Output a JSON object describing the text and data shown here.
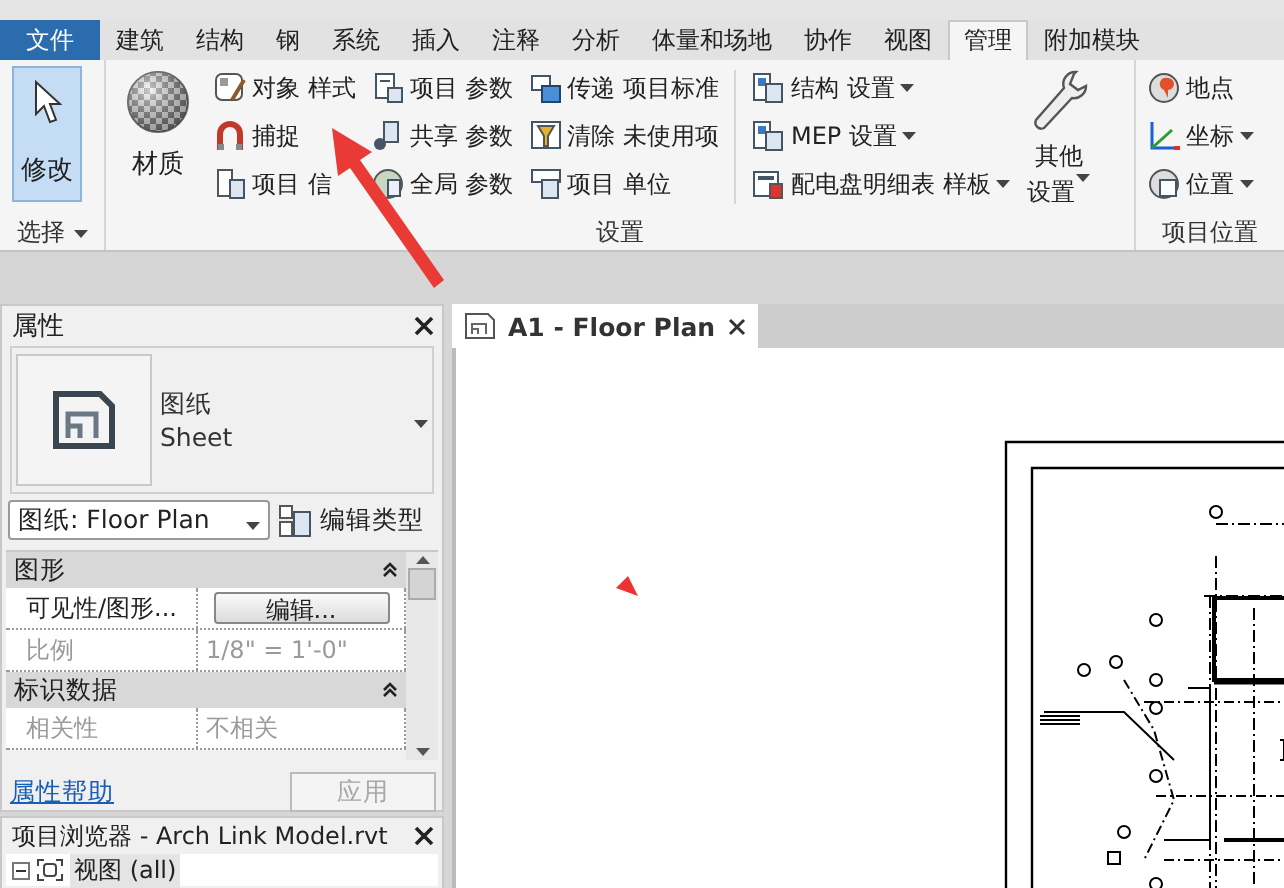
{
  "ribbon": {
    "tabs": [
      {
        "label": "文件",
        "kind": "file",
        "selected": false
      },
      {
        "label": "建筑",
        "kind": "tab",
        "selected": false
      },
      {
        "label": "结构",
        "kind": "tab",
        "selected": false
      },
      {
        "label": "钢",
        "kind": "tab",
        "selected": false
      },
      {
        "label": "系统",
        "kind": "tab",
        "selected": false
      },
      {
        "label": "插入",
        "kind": "tab",
        "selected": false
      },
      {
        "label": "注释",
        "kind": "tab",
        "selected": false
      },
      {
        "label": "分析",
        "kind": "tab",
        "selected": false
      },
      {
        "label": "体量和场地",
        "kind": "tab",
        "selected": false
      },
      {
        "label": "协作",
        "kind": "tab",
        "selected": false
      },
      {
        "label": "视图",
        "kind": "tab",
        "selected": false
      },
      {
        "label": "管理",
        "kind": "tab",
        "selected": true
      },
      {
        "label": "附加模块",
        "kind": "tab",
        "selected": false
      }
    ],
    "select_panel": {
      "title": "选择",
      "button": {
        "label": "修改",
        "selected": true
      }
    },
    "settings_panel": {
      "title": "设置",
      "material": "材质",
      "columns": [
        [
          {
            "label": "对象 样式",
            "dropdown": false
          },
          {
            "label": "捕捉",
            "dropdown": false
          },
          {
            "label": "项目 信",
            "dropdown": false
          }
        ],
        [
          {
            "label": "项目 参数",
            "dropdown": false
          },
          {
            "label": "共享 参数",
            "dropdown": false
          },
          {
            "label": "全局 参数",
            "dropdown": false
          }
        ],
        [
          {
            "label": "传递 项目标准",
            "dropdown": false
          },
          {
            "label": "清除 未使用项",
            "dropdown": false
          },
          {
            "label": "项目 单位",
            "dropdown": false
          }
        ],
        [
          {
            "label": "结构 设置",
            "dropdown": true
          },
          {
            "label": "MEP 设置",
            "dropdown": true
          },
          {
            "label": "配电盘明细表 样板",
            "dropdown": true
          }
        ]
      ],
      "other": {
        "label_1": "其他",
        "label_2": "设置"
      }
    },
    "location_panel": {
      "title": "项目位置",
      "items": [
        {
          "label": "地点",
          "dropdown": false
        },
        {
          "label": "坐标",
          "dropdown": true
        },
        {
          "label": "位置",
          "dropdown": true
        }
      ]
    }
  },
  "properties": {
    "title": "属性",
    "type_name": "图纸",
    "type_sub": "Sheet",
    "selector": "图纸: Floor Plan",
    "edit_type": "编辑类型",
    "rows": [
      {
        "kind": "section",
        "label": "图形"
      },
      {
        "kind": "button",
        "label": "可见性/图形...",
        "value": "编辑...",
        "disabled": false
      },
      {
        "kind": "value",
        "label": "比例",
        "value": "1/8\" = 1'-0\"",
        "disabled": true
      },
      {
        "kind": "section",
        "label": "标识数据"
      },
      {
        "kind": "value",
        "label": "相关性",
        "value": "不相关",
        "disabled": true
      }
    ],
    "help_link": "属性帮助",
    "apply": {
      "label": "应用",
      "disabled": true
    }
  },
  "project_browser": {
    "title": "项目浏览器 - Arch Link Model.rvt",
    "tree": [
      {
        "label": "视图 (all)",
        "expanded": true
      }
    ]
  },
  "view": {
    "tab": "A1 - Floor Plan"
  }
}
